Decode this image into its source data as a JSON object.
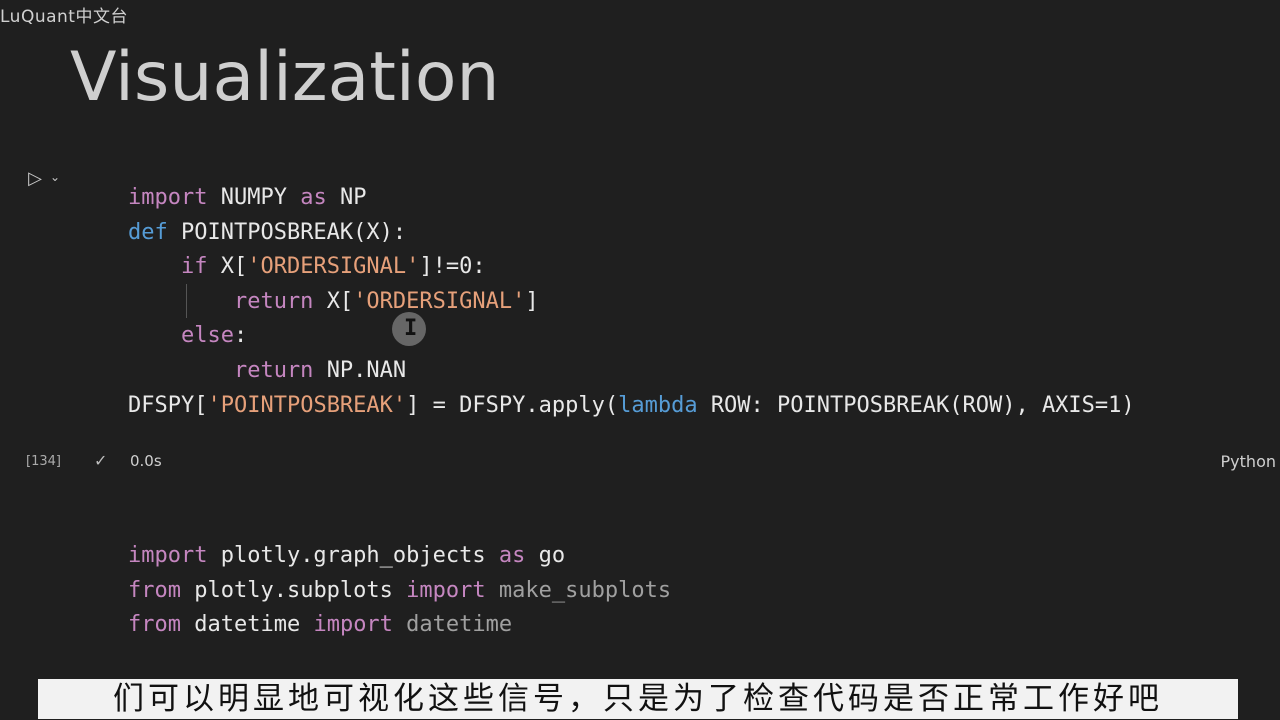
{
  "watermark": "LuQuant中文台",
  "markdown": {
    "title": "Visualization"
  },
  "cell1": {
    "exec_count": "[134]",
    "exec_time": "0.0s",
    "language": "Python",
    "lines": [
      [
        {
          "t": "import ",
          "c": "kw"
        },
        {
          "t": "NUMPY ",
          "c": "fn"
        },
        {
          "t": "as ",
          "c": "kw"
        },
        {
          "t": "NP",
          "c": "fn"
        }
      ],
      [
        {
          "t": "def ",
          "c": "kw2"
        },
        {
          "t": "POINTPOSBREAK(X):",
          "c": "fn"
        }
      ],
      [
        {
          "t": "    if ",
          "c": "kw"
        },
        {
          "t": "X[",
          "c": "fn"
        },
        {
          "t": "'ORDERSIGNAL'",
          "c": "str"
        },
        {
          "t": "]!=0:",
          "c": "fn"
        }
      ],
      [
        {
          "t": "        return ",
          "c": "kw"
        },
        {
          "t": "X[",
          "c": "fn"
        },
        {
          "t": "'ORDERSIGNAL'",
          "c": "str"
        },
        {
          "t": "]",
          "c": "fn"
        }
      ],
      [
        {
          "t": "    else",
          "c": "kw"
        },
        {
          "t": ":",
          "c": "fn"
        }
      ],
      [
        {
          "t": "        return ",
          "c": "kw"
        },
        {
          "t": "NP.NAN",
          "c": "fn"
        }
      ],
      [
        {
          "t": "DFSPY[",
          "c": "fn"
        },
        {
          "t": "'POINTPOSBREAK'",
          "c": "str"
        },
        {
          "t": "] = DFSPY.apply(",
          "c": "fn"
        },
        {
          "t": "lambda ",
          "c": "kw2"
        },
        {
          "t": "ROW: POINTPOSBREAK(ROW), AXIS=1)",
          "c": "fn"
        }
      ]
    ]
  },
  "cell2": {
    "lines": [
      [
        {
          "t": "import ",
          "c": "kw"
        },
        {
          "t": "plotly.graph_objects ",
          "c": "fn"
        },
        {
          "t": "as ",
          "c": "kw"
        },
        {
          "t": "go",
          "c": "fn"
        }
      ],
      [
        {
          "t": "from ",
          "c": "kw"
        },
        {
          "t": "plotly.subplots ",
          "c": "fn"
        },
        {
          "t": "import ",
          "c": "kw"
        },
        {
          "t": "make_subplots",
          "c": "dim"
        }
      ],
      [
        {
          "t": "from ",
          "c": "kw"
        },
        {
          "t": "datetime ",
          "c": "fn"
        },
        {
          "t": "import ",
          "c": "kw"
        },
        {
          "t": "datetime",
          "c": "dim"
        }
      ]
    ]
  },
  "subtitle": "们可以明显地可视化这些信号，只是为了检查代码是否正常工作好吧",
  "colors": {
    "background": "#1f1f1f",
    "keyword": "#c586c0",
    "string": "#e6a07a"
  }
}
